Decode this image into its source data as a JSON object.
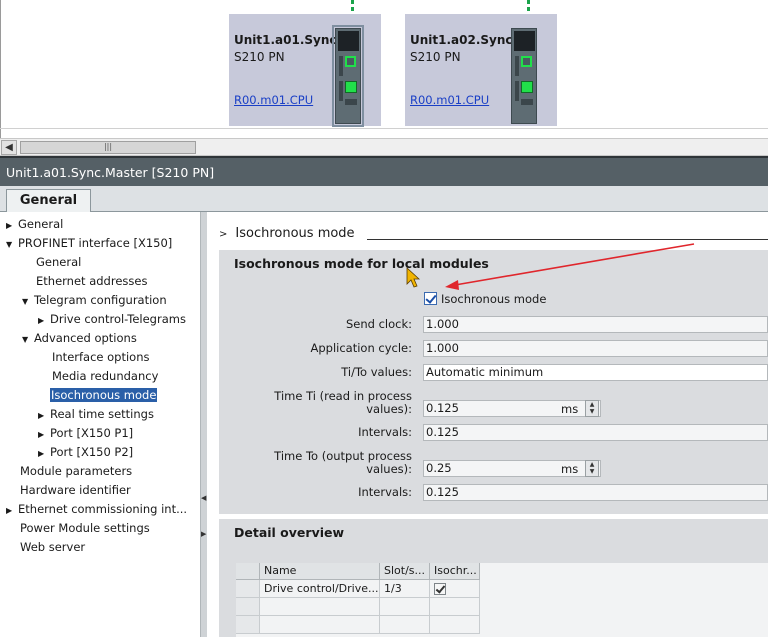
{
  "network": {
    "devices": [
      {
        "title": "Unit1.a01.Sync...",
        "type": "S210 PN",
        "link": "R00.m01.CPU",
        "selected": true
      },
      {
        "title": "Unit1.a02.Sync...",
        "type": "S210 PN",
        "link": "R00.m01.CPU",
        "selected": false
      }
    ],
    "scroll_thumb": "|||"
  },
  "inspector": {
    "title": "Unit1.a01.Sync.Master [S210 PN]",
    "tab": "General"
  },
  "nav": {
    "items": [
      {
        "label": "General",
        "expander": "▶"
      },
      {
        "label": "PROFINET interface [X150]",
        "expander": "▼"
      },
      {
        "label": "General",
        "expander": ""
      },
      {
        "label": "Ethernet addresses",
        "expander": ""
      },
      {
        "label": "Telegram configuration",
        "expander": "▼"
      },
      {
        "label": "Drive control-Telegrams",
        "expander": "▶"
      },
      {
        "label": "Advanced options",
        "expander": "▼"
      },
      {
        "label": "Interface options",
        "expander": ""
      },
      {
        "label": "Media redundancy",
        "expander": ""
      },
      {
        "label": "Isochronous mode",
        "expander": "",
        "selected": true
      },
      {
        "label": "Real time settings",
        "expander": "▶"
      },
      {
        "label": "Port [X150 P1]",
        "expander": "▶"
      },
      {
        "label": "Port [X150 P2]",
        "expander": "▶"
      },
      {
        "label": "Module parameters",
        "expander": ""
      },
      {
        "label": "Hardware identifier",
        "expander": ""
      },
      {
        "label": "Ethernet commissioning int...",
        "expander": "▶"
      },
      {
        "label": "Power Module settings",
        "expander": ""
      },
      {
        "label": "Web server",
        "expander": ""
      }
    ]
  },
  "content": {
    "section_title": "Isochronous mode",
    "iso_panel": {
      "title": "Isochronous mode for local modules",
      "checkbox_label": "Isochronous mode",
      "send_clock_label": "Send clock:",
      "send_clock_value": "1.000",
      "app_cycle_label": "Application cycle:",
      "app_cycle_value": "1.000",
      "tito_label": "Ti/To values:",
      "tito_value": "Automatic minimum",
      "ti_label_1": "Time Ti (read in process",
      "ti_label_2": "values):",
      "ti_value": "0.125",
      "ti_unit": "ms",
      "intervals_label_1": "Intervals:",
      "intervals_value_1": "0.125",
      "to_label_1": "Time To (output process",
      "to_label_2": "values):",
      "to_value": "0.25",
      "to_unit": "ms",
      "intervals_label_2": "Intervals:",
      "intervals_value_2": "0.125"
    },
    "detail_panel": {
      "title": "Detail overview",
      "columns": [
        "Name",
        "Slot/s...",
        "Isochr..."
      ],
      "rows": [
        {
          "name": "Drive control/Drive...",
          "slot": "1/3",
          "iso": true
        }
      ]
    }
  },
  "colors": {
    "accent": "#2a5fa8",
    "header": "#556066",
    "annotation_arrow": "#e0262c"
  }
}
